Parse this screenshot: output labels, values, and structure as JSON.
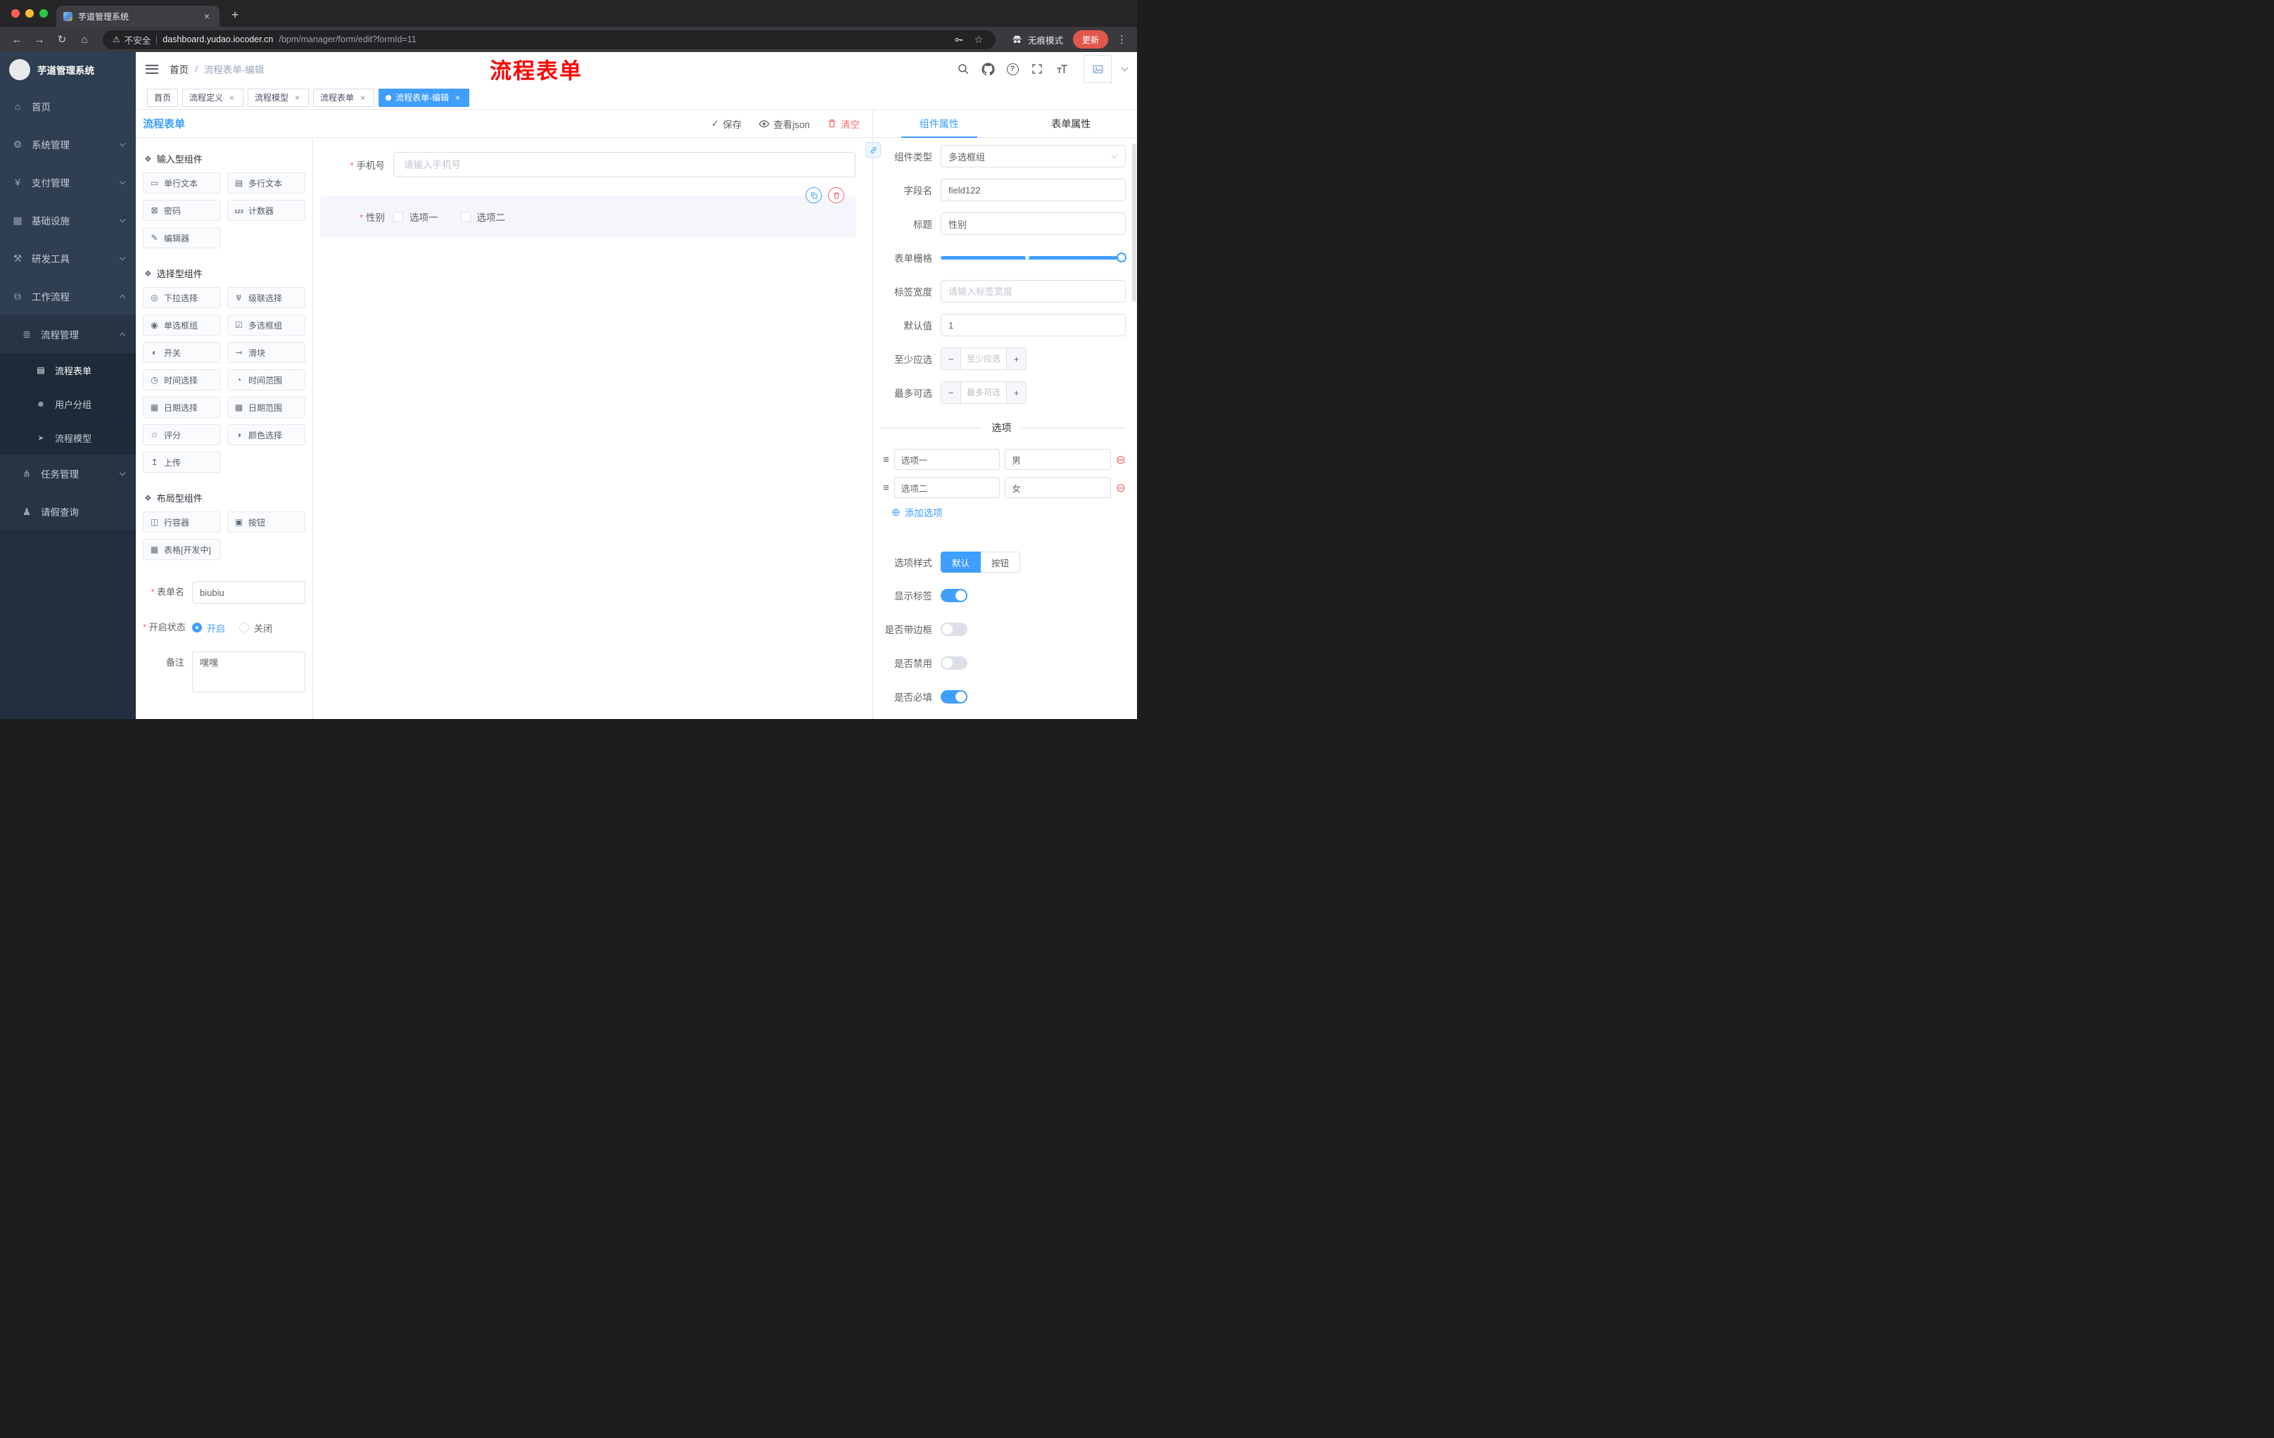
{
  "theme": {
    "accent": "#409eff",
    "danger": "#f56c6c",
    "sidebar_bg": "#2f3e50",
    "overlay_title_color": "#ff0000",
    "update_button_color": "#e2574b"
  },
  "browser": {
    "tab_title": "芋道管理系统",
    "address": {
      "warning": "不安全",
      "host": "dashboard.yudao.iocoder.cn",
      "path": "/bpm/manager/form/edit?formId=11"
    },
    "incognito_label": "无痕模式",
    "update_label": "更新"
  },
  "sidebar": {
    "logo_title": "芋道管理系统",
    "items": [
      {
        "label": "首页",
        "icon": "home-icon"
      },
      {
        "label": "系统管理",
        "icon": "gear-icon"
      },
      {
        "label": "支付管理",
        "icon": "payment-icon"
      },
      {
        "label": "基础设施",
        "icon": "infrastructure-icon"
      },
      {
        "label": "研发工具",
        "icon": "devtools-icon"
      },
      {
        "label": "工作流程",
        "icon": "workflow-icon"
      },
      {
        "label": "流程管理",
        "icon": "process-management-icon"
      },
      {
        "label": "流程表单",
        "icon": "process-form-icon"
      },
      {
        "label": "用户分组",
        "icon": "user-group-icon"
      },
      {
        "label": "流程模型",
        "icon": "process-model-icon"
      },
      {
        "label": "任务管理",
        "icon": "task-management-icon"
      },
      {
        "label": "请假查询",
        "icon": "leave-query-icon"
      }
    ]
  },
  "header": {
    "breadcrumb": [
      "首页",
      "流程表单-编辑"
    ],
    "overlay_title": "流程表单"
  },
  "tags": [
    {
      "label": "首页"
    },
    {
      "label": "流程定义"
    },
    {
      "label": "流程模型"
    },
    {
      "label": "流程表单"
    },
    {
      "label": "流程表单-编辑"
    }
  ],
  "designer": {
    "panel_title": "流程表单",
    "actions": {
      "save": "保存",
      "view_json": "查看json",
      "clear": "清空"
    },
    "palette": {
      "sections": [
        {
          "title": "输入型组件",
          "items": [
            {
              "label": "单行文本",
              "icon": "single-line-text-icon"
            },
            {
              "label": "多行文本",
              "icon": "multi-line-text-icon"
            },
            {
              "label": "密码",
              "icon": "password-icon"
            },
            {
              "label": "计数器",
              "icon": "counter-icon"
            },
            {
              "label": "编辑器",
              "icon": "editor-icon"
            }
          ]
        },
        {
          "title": "选择型组件",
          "items": [
            {
              "label": "下拉选择",
              "icon": "select-icon"
            },
            {
              "label": "级联选择",
              "icon": "cascader-icon"
            },
            {
              "label": "单选框组",
              "icon": "radio-group-icon"
            },
            {
              "label": "多选框组",
              "icon": "checkbox-group-icon"
            },
            {
              "label": "开关",
              "icon": "switch-icon"
            },
            {
              "label": "滑块",
              "icon": "slider-icon"
            },
            {
              "label": "时间选择",
              "icon": "time-picker-icon"
            },
            {
              "label": "时间范围",
              "icon": "time-range-icon"
            },
            {
              "label": "日期选择",
              "icon": "date-picker-icon"
            },
            {
              "label": "日期范围",
              "icon": "date-range-icon"
            },
            {
              "label": "评分",
              "icon": "rate-icon"
            },
            {
              "label": "颜色选择",
              "icon": "color-picker-icon"
            },
            {
              "label": "上传",
              "icon": "upload-icon"
            }
          ]
        },
        {
          "title": "布局型组件",
          "items": [
            {
              "label": "行容器",
              "icon": "row-container-icon"
            },
            {
              "label": "按钮",
              "icon": "button-icon"
            },
            {
              "label": "表格[开发中]",
              "icon": "table-icon"
            }
          ]
        }
      ]
    },
    "settings": {
      "form_name_label": "表单名",
      "form_name_value": "biubiu",
      "status_label": "开启状态",
      "status_on": "开启",
      "status_off": "关闭",
      "remark_label": "备注",
      "remark_value": "嘿嘿"
    },
    "canvas": {
      "phone_label": "手机号",
      "phone_placeholder": "请输入手机号",
      "gender_label": "性别",
      "gender_options": [
        "选项一",
        "选项二"
      ]
    }
  },
  "props": {
    "tabs": [
      "组件属性",
      "表单属性"
    ],
    "component_type_label": "组件类型",
    "component_type_value": "多选框组",
    "field_name_label": "字段名",
    "field_name_value": "field122",
    "title_label": "标题",
    "title_value": "性别",
    "grid_label": "表单栅格",
    "label_width_label": "标签宽度",
    "label_width_placeholder": "请输入标签宽度",
    "default_label": "默认值",
    "default_value": "1",
    "min_label": "至少应选",
    "min_placeholder": "至少应选",
    "max_label": "最多可选",
    "max_placeholder": "最多可选",
    "options_title": "选项",
    "options": [
      {
        "label": "选项一",
        "value": "男"
      },
      {
        "label": "选项二",
        "value": "女"
      }
    ],
    "add_option": "添加选项",
    "option_style_label": "选项样式",
    "option_style_choices": [
      "默认",
      "按钮"
    ],
    "switches": [
      {
        "label": "显示标签",
        "on": true
      },
      {
        "label": "是否带边框",
        "on": false
      },
      {
        "label": "是否禁用",
        "on": false
      },
      {
        "label": "是否必填",
        "on": true
      }
    ]
  }
}
